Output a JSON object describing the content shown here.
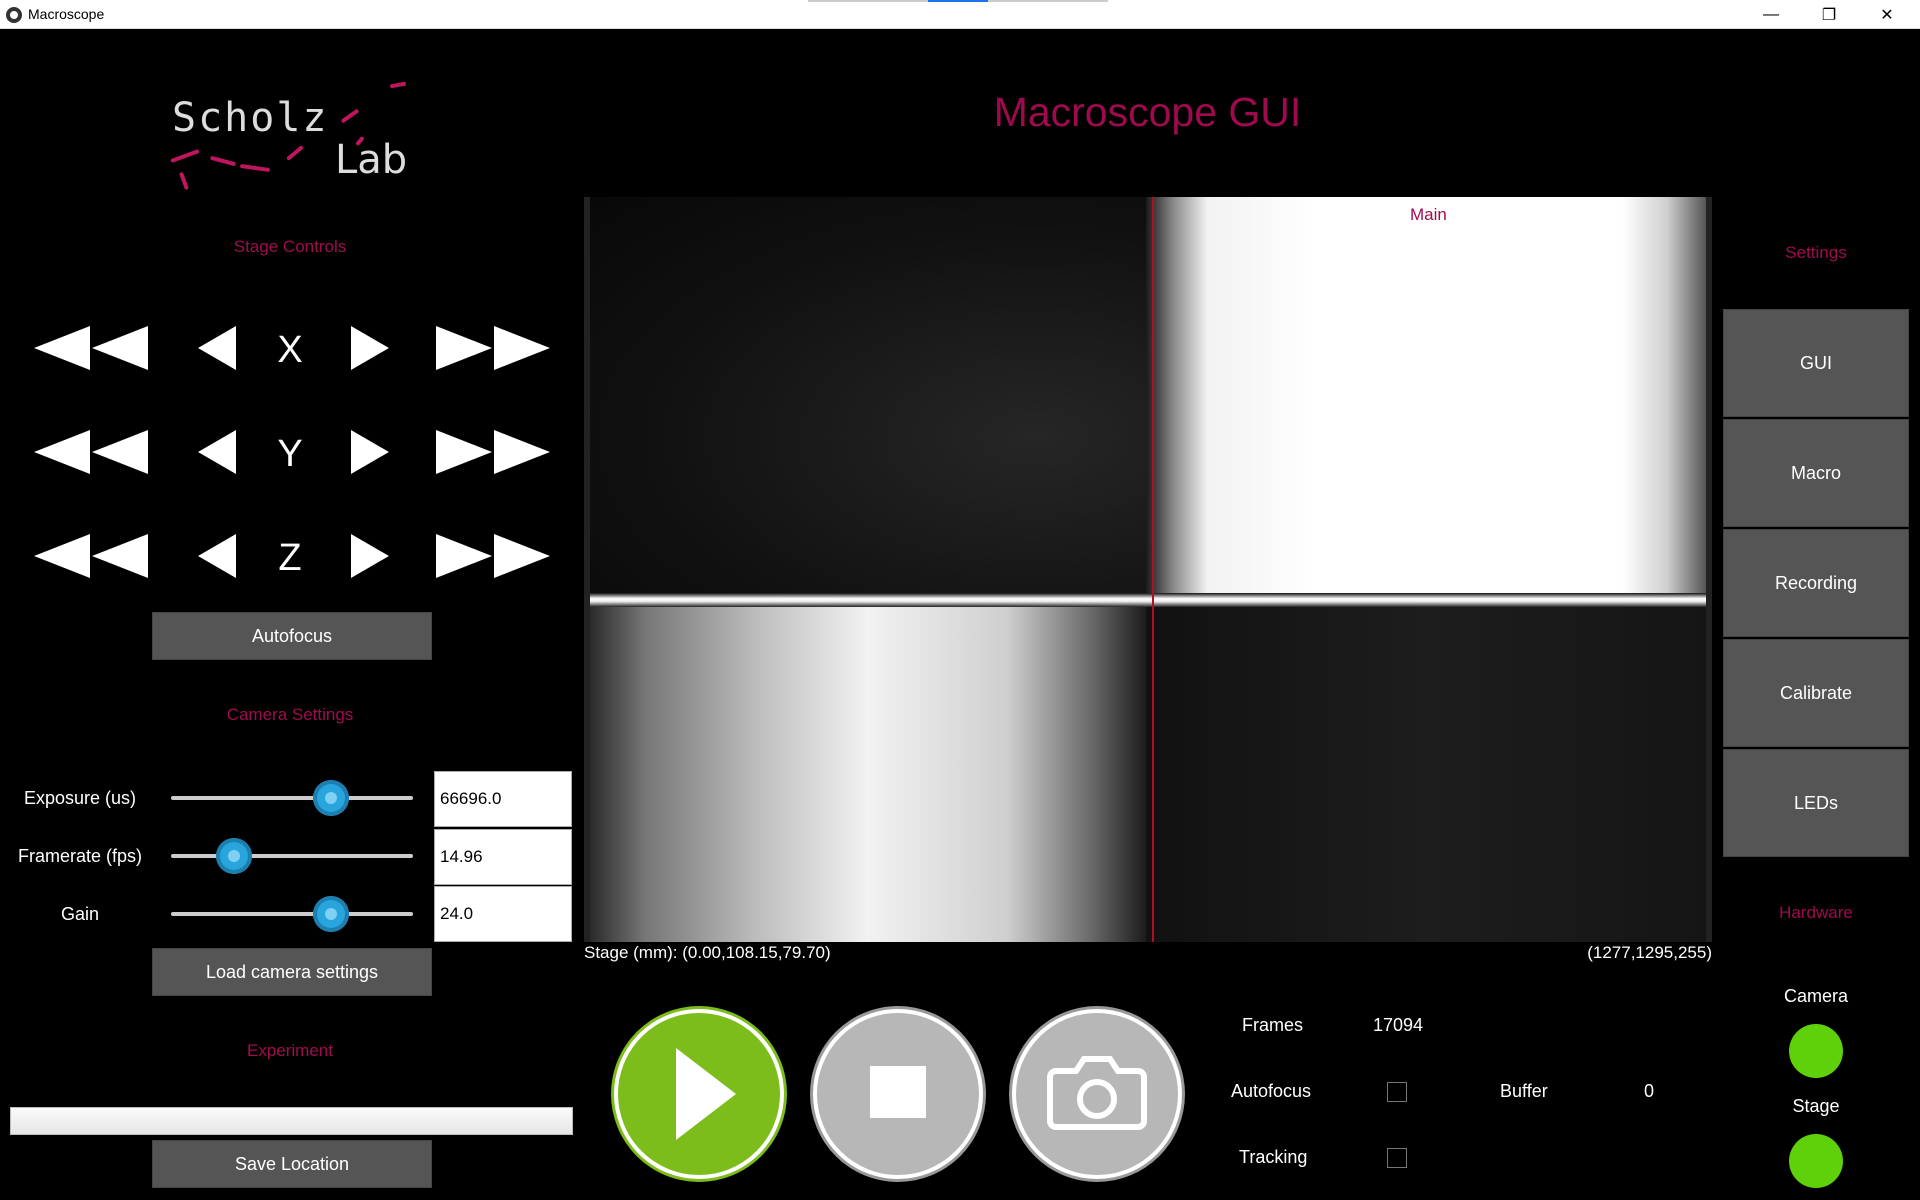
{
  "window": {
    "title": "Macroscope",
    "minimize": "—",
    "maximize": "❐",
    "close": "✕"
  },
  "logo": {
    "line1": "Scholz",
    "line2": "Lab"
  },
  "app_title": "Macroscope GUI",
  "stage_controls": {
    "title": "Stage Controls",
    "axes": [
      "X",
      "Y",
      "Z"
    ]
  },
  "autofocus_button": "Autofocus",
  "camera_settings": {
    "title": "Camera Settings",
    "exposure": {
      "label": "Exposure (us)",
      "value": "66696.0",
      "level": 0.66
    },
    "framerate": {
      "label": "Framerate (fps)",
      "value": "14.96",
      "level": 0.26
    },
    "gain": {
      "label": "Gain",
      "value": "24.0",
      "level": 0.66
    },
    "load_button": "Load camera settings"
  },
  "experiment": {
    "title": "Experiment",
    "progress": 0,
    "save_button": "Save Location"
  },
  "camera_view": {
    "label": "Main",
    "stage_text": "Stage (mm): (0.00,108.15,79.70)",
    "pixel_text": "(1277,1295,255)"
  },
  "controls": {
    "play": "play-icon",
    "stop": "stop-icon",
    "snapshot": "camera-icon"
  },
  "info": {
    "frames_label": "Frames",
    "frames_value": "17094",
    "autofocus_label": "Autofocus",
    "buffer_label": "Buffer",
    "buffer_value": "0",
    "tracking_label": "Tracking"
  },
  "settings": {
    "title": "Settings",
    "buttons": [
      "GUI",
      "Macro",
      "Recording",
      "Calibrate",
      "LEDs"
    ]
  },
  "hardware": {
    "title": "Hardware",
    "camera_label": "Camera",
    "stage_label": "Stage",
    "status_color": "#5ed10a"
  },
  "colors": {
    "accent": "#a00c4e",
    "play": "#7cbd1b"
  }
}
